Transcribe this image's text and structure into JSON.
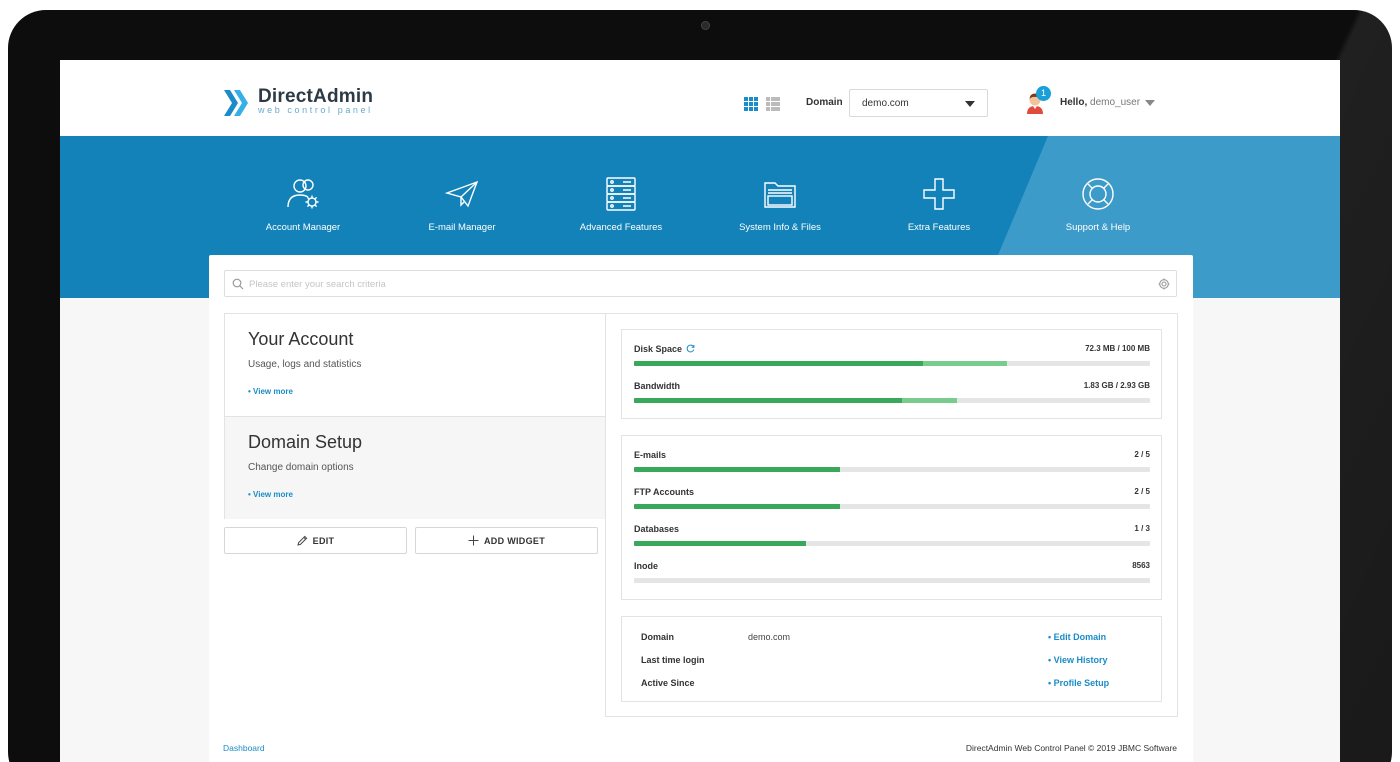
{
  "app": {
    "name": "DirectAdmin",
    "tagline": "web control panel"
  },
  "header": {
    "domain_label": "Domain",
    "domain_value": "demo.com",
    "notification_count": "1",
    "greeting": "Hello,",
    "username": "demo_user"
  },
  "nav": [
    {
      "label": "Account Manager",
      "icon": "users-gear-icon"
    },
    {
      "label": "E-mail Manager",
      "icon": "paper-plane-icon"
    },
    {
      "label": "Advanced Features",
      "icon": "server-icon"
    },
    {
      "label": "System Info & Files",
      "icon": "folder-icon"
    },
    {
      "label": "Extra Features",
      "icon": "plus-icon"
    },
    {
      "label": "Support & Help",
      "icon": "lifebuoy-icon"
    }
  ],
  "search": {
    "placeholder": "Please enter your search criteria"
  },
  "cards": [
    {
      "title": "Your Account",
      "subtitle": "Usage, logs and statistics",
      "link": "• View more"
    },
    {
      "title": "Domain Setup",
      "subtitle": "Change domain options",
      "link": "• View more"
    }
  ],
  "buttons": {
    "edit": "EDIT",
    "add_widget": "ADD WIDGET"
  },
  "usage": [
    {
      "name": "Disk Space",
      "value": "72.3 MB / 100 MB",
      "fraction": 0.56,
      "secondary_fraction": 0.723
    },
    {
      "name": "Bandwidth",
      "value": "1.83 GB / 2.93 GB",
      "fraction": 0.52,
      "secondary_fraction": 0.625
    }
  ],
  "limits": [
    {
      "name": "E-mails",
      "value": "2 / 5",
      "fraction": 0.4
    },
    {
      "name": "FTP Accounts",
      "value": "2 / 5",
      "fraction": 0.4
    },
    {
      "name": "Databases",
      "value": "1 / 3",
      "fraction": 0.333
    },
    {
      "name": "Inode",
      "value": "8563",
      "fraction": 0
    }
  ],
  "info": [
    {
      "key": "Domain",
      "value": "demo.com",
      "action": "• Edit Domain"
    },
    {
      "key": "Last time login",
      "value": "",
      "action": "• View History"
    },
    {
      "key": "Active Since",
      "value": "",
      "action": "• Profile Setup"
    }
  ],
  "footer": {
    "breadcrumb": "Dashboard",
    "copyright": "DirectAdmin Web Control Panel © 2019 JBMC Software"
  },
  "colors": {
    "primary": "#1282b8",
    "accent_link": "#1a8cc8",
    "bar_fill": "#39a85a",
    "bar_fill_light": "#79cc8e"
  }
}
